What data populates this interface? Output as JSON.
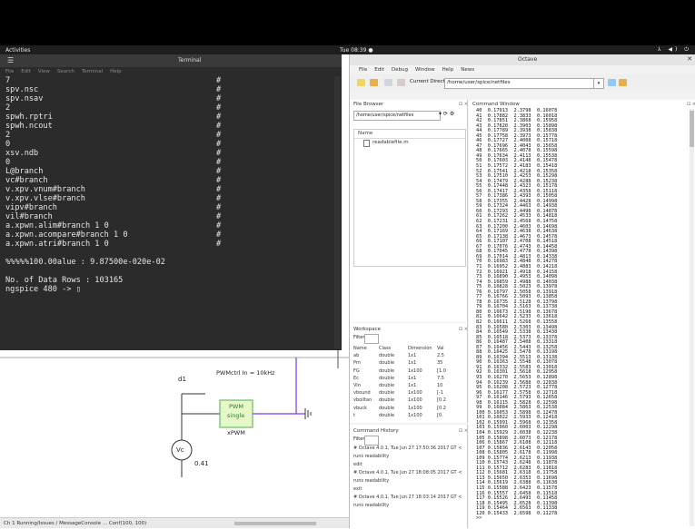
{
  "topbar": {
    "activities": "Activities",
    "clock": "Tue 08:39 ●",
    "tray": "⅄ ◀) ⏻"
  },
  "terminal": {
    "title": "Terminal",
    "menu": [
      "File",
      "Edit",
      "View",
      "Search",
      "Terminal",
      "Help"
    ],
    "lines": [
      {
        "text": "7",
        "hash": "#"
      },
      {
        "text": "spv.nsc",
        "hash": "#"
      },
      {
        "text": "spv.nsav",
        "hash": "#"
      },
      {
        "text": "2",
        "hash": "#"
      },
      {
        "text": "spwh.rptri",
        "hash": "#"
      },
      {
        "text": "spwh.ncout",
        "hash": "#"
      },
      {
        "text": "2",
        "hash": "#"
      },
      {
        "text": "0",
        "hash": "#"
      },
      {
        "text": "xsv.ndb",
        "hash": "#"
      },
      {
        "text": "0",
        "hash": "#"
      },
      {
        "text": "L@branch",
        "hash": "#"
      },
      {
        "text": "vc#branch",
        "hash": "#"
      },
      {
        "text": "v.xpv.vnum#branch",
        "hash": "#"
      },
      {
        "text": "v.xpv.vlse#branch",
        "hash": "#"
      },
      {
        "text": "vipv#branch",
        "hash": "#"
      },
      {
        "text": "vil#branch",
        "hash": "#"
      },
      {
        "text": "a.xpwn.alim#branch 1 0",
        "hash": "#"
      },
      {
        "text": "a.xpwn.acompare#branch 1 0",
        "hash": "#"
      },
      {
        "text": "a.xpwn.atri#branch 1 0",
        "hash": "#"
      },
      {
        "text": "",
        "hash": ""
      },
      {
        "text": "%%%%%100.00alue : 9.87500e-020e-02",
        "hash": ""
      },
      {
        "text": "",
        "hash": ""
      },
      {
        "text": "No. of Data Rows : 103165",
        "hash": ""
      },
      {
        "text": "ngspice 480 -> ▯",
        "hash": ""
      }
    ]
  },
  "diagram": {
    "d1_label": "d1",
    "pwm_label": "PWMctrl In = 10kHz",
    "block_line1": "PWM",
    "block_line2": "single",
    "block_name": "xPWM",
    "source_label": "Vc",
    "source_value": "0.41"
  },
  "status_bar": {
    "text": "Ch 1 Running/Issues / MessageConsole ... Conf(100, 100)"
  },
  "octave": {
    "title": "Octave",
    "menu": [
      "File",
      "Edit",
      "Debug",
      "Window",
      "Help",
      "News"
    ],
    "dir_label": "Current Directory:",
    "dir_value": "/home/user/spice/netfiles",
    "file_browser": {
      "title": "File Browser",
      "path": "/home/user/spice/netfiles",
      "col_name": "Name",
      "files": [
        "readablefile.m"
      ]
    },
    "workspace": {
      "title": "Workspace",
      "filter_label": "Filter",
      "headers": [
        "Name",
        "Class",
        "Dimension",
        "Val"
      ],
      "rows": [
        [
          "ab",
          "double",
          "1x1",
          "2.5"
        ],
        [
          "Pm",
          "double",
          "1x1",
          "35"
        ],
        [
          "FG",
          "double",
          "1x100",
          "[1.0"
        ],
        [
          "Ec",
          "double",
          "1x1",
          "7.5"
        ],
        [
          "Vin",
          "double",
          "1x1",
          "10"
        ],
        [
          "vbound",
          "double",
          "1x100",
          "[-1"
        ],
        [
          "vboiltan",
          "double",
          "1x100",
          "[0.2"
        ],
        [
          "vbuck",
          "double",
          "1x100",
          "[0.2"
        ],
        [
          "t",
          "double",
          "1x100",
          "[0."
        ]
      ]
    },
    "history": {
      "title": "Command History",
      "filter_label": "Filter",
      "lines": [
        "# Octave 4.0.1, Tue Jun 27 17:50:36 2017 GT <",
        "runs readability",
        "edit",
        "# Octave 4.0.1, Tue Jun 27 18:08:05 2017 GT <",
        "runs readability",
        "exit",
        "# Octave 4.0.1, Tue Jun 27 18:03:14 2017 GT <",
        "runs readability"
      ]
    },
    "command_window": {
      "title": "Command Window",
      "rows": [
        "40  0.17913  2.3798  0.16078",
        "41  0.17882  2.3833  0.16018",
        "42  0.17851  2.3868  0.15958",
        "43  0.17820  2.3903  0.15898",
        "44  0.17789  2.3938  0.15838",
        "45  0.17758  2.3973  0.15778",
        "46  0.17727  2.4008  0.15718",
        "47  0.17696  2.4043  0.15658",
        "48  0.17665  2.4078  0.15598",
        "49  0.17634  2.4113  0.15538",
        "50  0.17603  2.4148  0.15478",
        "51  0.17572  2.4183  0.15418",
        "52  0.17541  2.4218  0.15358",
        "53  0.17510  2.4253  0.15298",
        "54  0.17479  2.4288  0.15238",
        "55  0.17448  2.4323  0.15178",
        "56  0.17417  2.4358  0.15118",
        "57  0.17386  2.4393  0.15058",
        "58  0.17355  2.4428  0.14998",
        "59  0.17324  2.4463  0.14938",
        "60  0.17293  2.4498  0.14878",
        "61  0.17262  2.4533  0.14818",
        "62  0.17231  2.4568  0.14758",
        "63  0.17200  2.4603  0.14698",
        "64  0.17169  2.4638  0.14638",
        "65  0.17138  2.4673  0.14578",
        "66  0.17107  2.4708  0.14518",
        "67  0.17076  2.4743  0.14458",
        "68  0.17045  2.4778  0.14398",
        "69  0.17014  2.4813  0.14338",
        "70  0.16983  2.4848  0.14278",
        "71  0.16952  2.4883  0.14218",
        "72  0.16921  2.4918  0.14158",
        "73  0.16890  2.4953  0.14098",
        "74  0.16859  2.4988  0.14038",
        "75  0.16828  2.5023  0.13978",
        "76  0.16797  2.5058  0.13918",
        "77  0.16766  2.5093  0.13858",
        "78  0.16735  2.5128  0.13798",
        "79  0.16704  2.5163  0.13738",
        "80  0.16673  2.5198  0.13678",
        "81  0.16642  2.5233  0.13618",
        "82  0.16611  2.5268  0.13558",
        "83  0.16580  2.5303  0.13498",
        "84  0.16549  2.5338  0.13438",
        "85  0.16518  2.5373  0.13378",
        "86  0.16487  2.5408  0.13318",
        "87  0.16456  2.5443  0.13258",
        "88  0.16425  2.5478  0.13198",
        "89  0.16394  2.5513  0.13138",
        "90  0.16363  2.5548  0.13078",
        "91  0.16332  2.5583  0.13018",
        "92  0.16301  2.5618  0.12958",
        "93  0.16270  2.5653  0.12898",
        "94  0.16239  2.5688  0.12838",
        "95  0.16208  2.5723  0.12778",
        "96  0.16177  2.5758  0.12718",
        "97  0.16146  2.5793  0.12658",
        "98  0.16115  2.5828  0.12598",
        "99  0.16084  2.5863  0.12538",
        "100 0.16053  2.5898  0.12478",
        "101 0.16022  2.5933  0.12418",
        "102 0.15991  2.5968  0.12358",
        "103 0.15960  2.6003  0.12298",
        "104 0.15929  2.6038  0.12238",
        "105 0.15898  2.6073  0.12178",
        "106 0.15867  2.6108  0.12118",
        "107 0.15836  2.6143  0.12058",
        "108 0.15805  2.6178  0.11998",
        "109 0.15774  2.6213  0.11938",
        "110 0.15743  2.6248  0.11878",
        "111 0.15712  2.6283  0.11818",
        "112 0.15681  2.6318  0.11758",
        "113 0.15650  2.6353  0.11698",
        "114 0.15619  2.6388  0.11638",
        "115 0.15588  2.6423  0.11578",
        "116 0.15557  2.6458  0.11518",
        "117 0.15526  2.6493  0.11458",
        "118 0.15495  2.6528  0.11398",
        "119 0.15464  2.6563  0.11338",
        "120 0.15433  2.6598  0.11278",
        ">>"
      ]
    }
  }
}
